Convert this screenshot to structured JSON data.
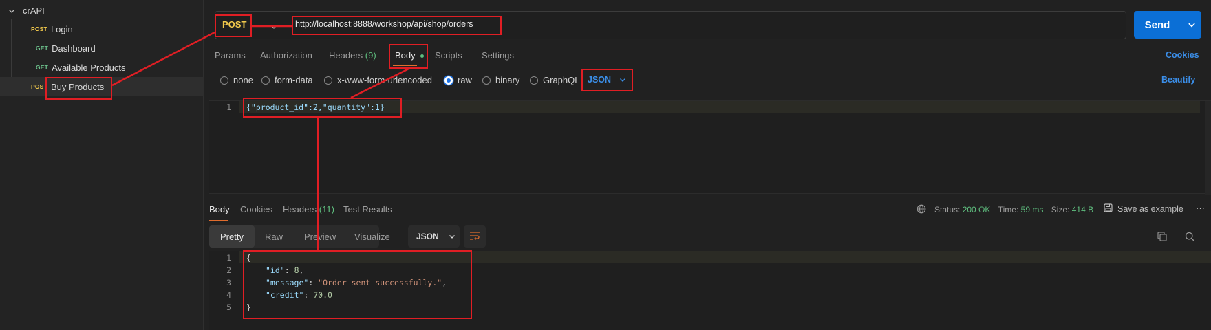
{
  "sidebar": {
    "collection": "crAPI",
    "items": [
      {
        "method": "POST",
        "label": "Login"
      },
      {
        "method": "GET",
        "label": "Dashboard"
      },
      {
        "method": "GET",
        "label": "Available Products"
      },
      {
        "method": "POST",
        "label": "Buy Products"
      }
    ]
  },
  "request": {
    "method": "POST",
    "url": "http://localhost:8888/workshop/api/shop/orders",
    "send_label": "Send"
  },
  "request_tabs": {
    "params": "Params",
    "authorization": "Authorization",
    "headers": "Headers",
    "headers_count": "(9)",
    "body": "Body",
    "scripts": "Scripts",
    "settings": "Settings",
    "cookies": "Cookies"
  },
  "body_types": {
    "none": "none",
    "form_data": "form-data",
    "urlencoded": "x-www-form-urlencoded",
    "raw": "raw",
    "binary": "binary",
    "graphql": "GraphQL",
    "format": "JSON",
    "beautify": "Beautify",
    "selected": "raw"
  },
  "request_body": {
    "line": "1",
    "text": "{\"product_id\":2,\"quantity\":1}"
  },
  "response_tabs": {
    "body": "Body",
    "cookies": "Cookies",
    "headers": "Headers",
    "headers_count": "(11)",
    "test_results": "Test Results"
  },
  "response_status": {
    "status_label": "Status:",
    "status_value": "200 OK",
    "time_label": "Time:",
    "time_value": "59 ms",
    "size_label": "Size:",
    "size_value": "414 B",
    "save_label": "Save as example",
    "more": "···"
  },
  "response_view": {
    "pretty": "Pretty",
    "raw": "Raw",
    "preview": "Preview",
    "visualize": "Visualize",
    "format": "JSON"
  },
  "response_body": {
    "line_numbers": [
      "1",
      "2",
      "3",
      "4",
      "5"
    ],
    "open_brace": "{",
    "close_brace": "}",
    "id_key": "\"id\"",
    "id_value": "8",
    "message_key": "\"message\"",
    "message_value": "\"Order sent successfully.\"",
    "credit_key": "\"credit\"",
    "credit_value": "70.0"
  },
  "colors": {
    "accent": "#0b6fd6",
    "annotation": "#e01e24",
    "method_post": "#f2c94c",
    "method_get": "#6cc08b",
    "status_ok": "#5fbf7f"
  }
}
